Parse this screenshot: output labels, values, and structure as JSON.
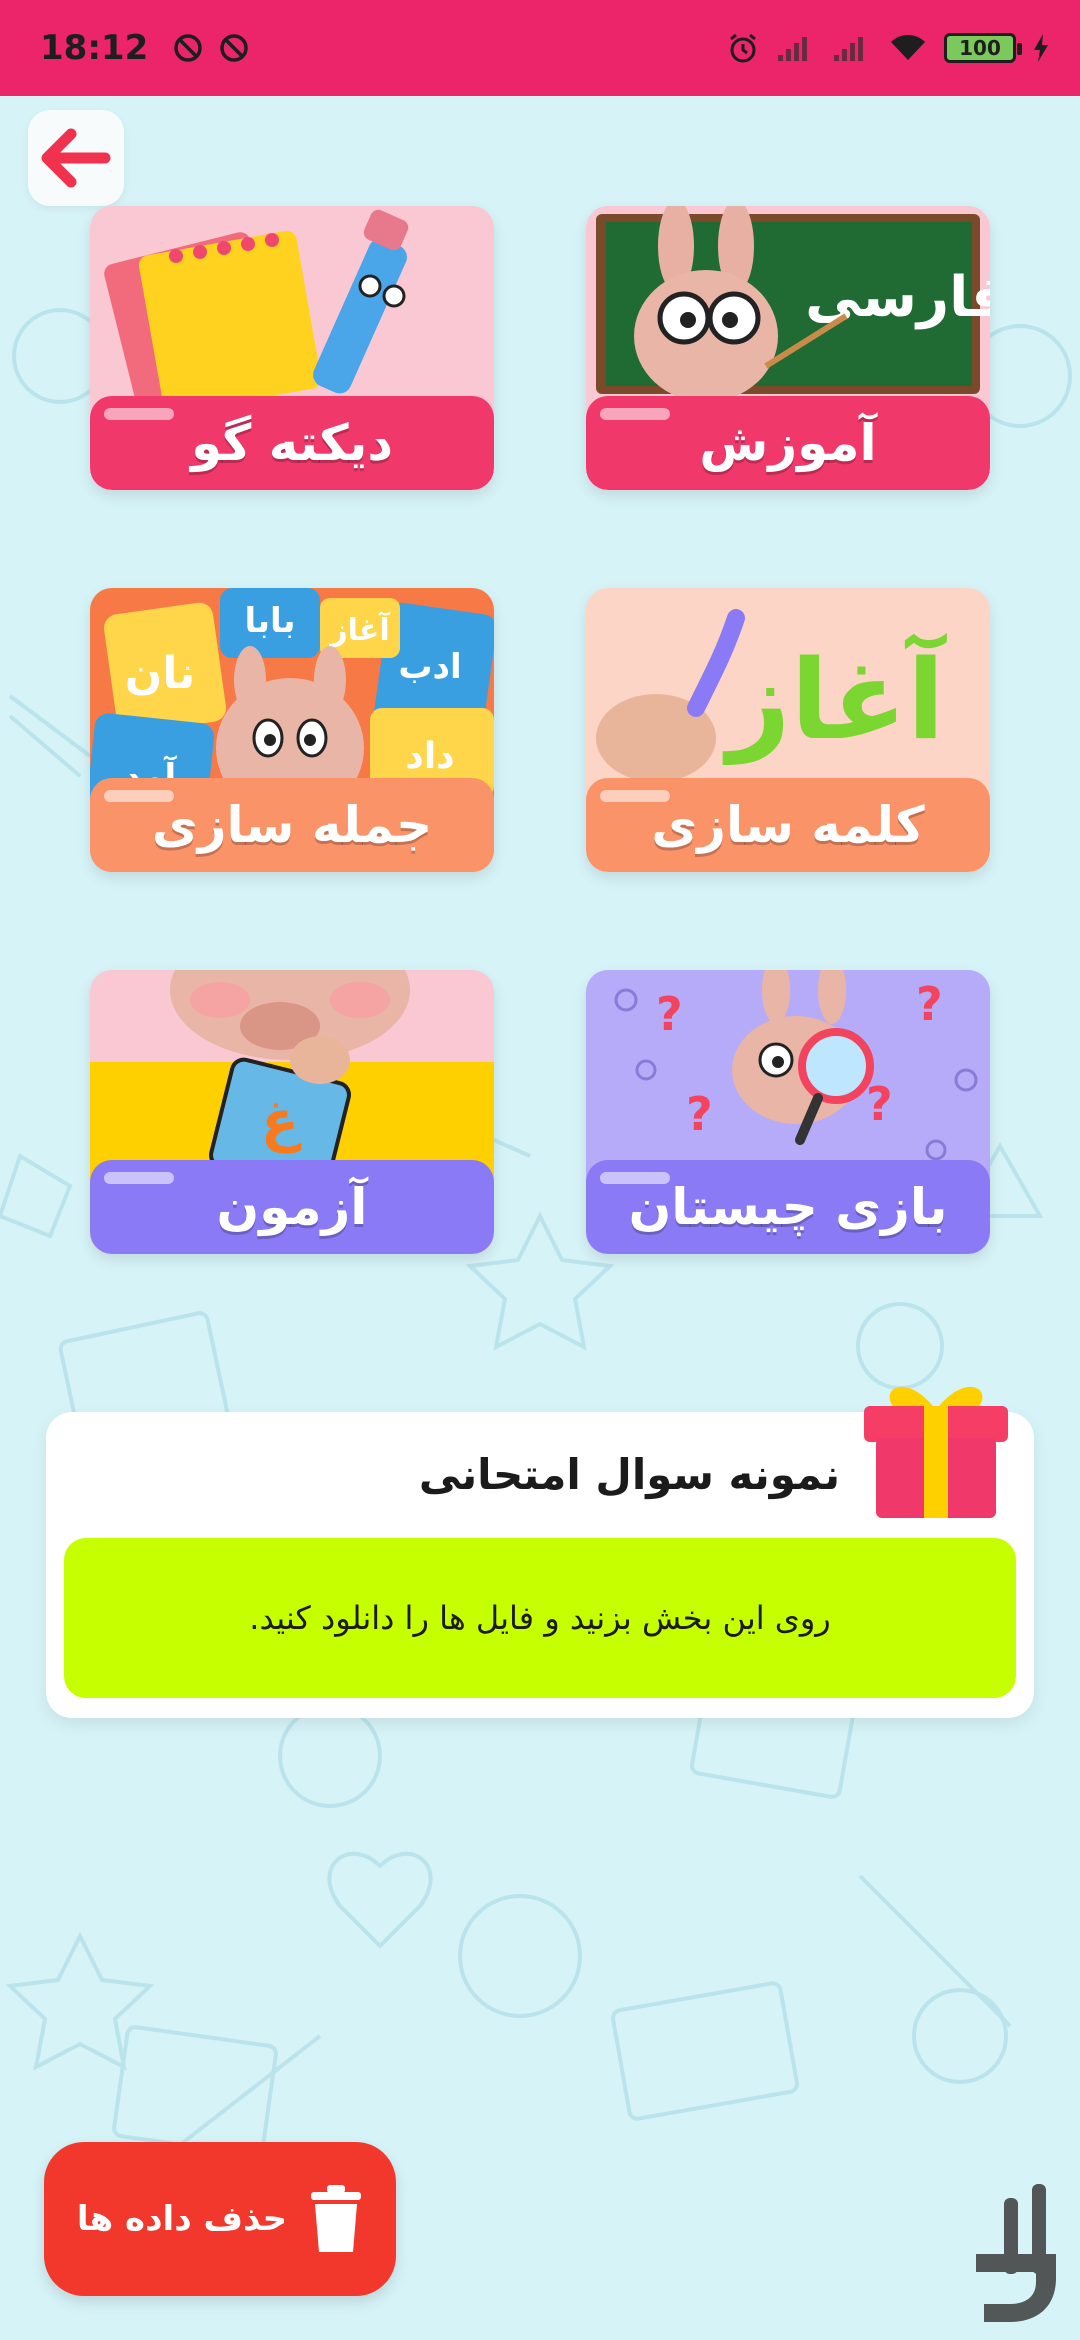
{
  "status_bar": {
    "time": "18:12",
    "battery": "100"
  },
  "tiles": [
    {
      "label": "دیکته گو",
      "art_text": "",
      "color": "#f0386a"
    },
    {
      "label": "آموزش",
      "art_text": "فارسی",
      "color": "#f0386a"
    },
    {
      "label": "جمله سازی",
      "art_text": "",
      "color": "#fb9369"
    },
    {
      "label": "کلمه سازی",
      "art_text": "آغاز",
      "color": "#fb9369"
    },
    {
      "label": "آزمون",
      "art_text": "",
      "color": "#8a7af5"
    },
    {
      "label": "بازی چیستان",
      "art_text": "",
      "color": "#8a7af5"
    }
  ],
  "sentence_words": [
    "آغاز",
    "بابا",
    "نان",
    "ادب",
    "داد",
    "آمد"
  ],
  "exam": {
    "title": "نمونه سوال امتحانی",
    "description": "روی این بخش بزنید و فایل ها را دانلود کنید."
  },
  "delete_button": {
    "label": "حذف داده ها"
  },
  "colors": {
    "status_bar": "#ec2469",
    "background": "#d6f3f7",
    "banner": "#c6ff00",
    "delete": "#f2382d"
  },
  "icons": [
    "back-arrow-icon",
    "trash-icon",
    "gift-icon",
    "alarm-icon",
    "wifi-icon",
    "battery-icon",
    "charging-icon"
  ]
}
